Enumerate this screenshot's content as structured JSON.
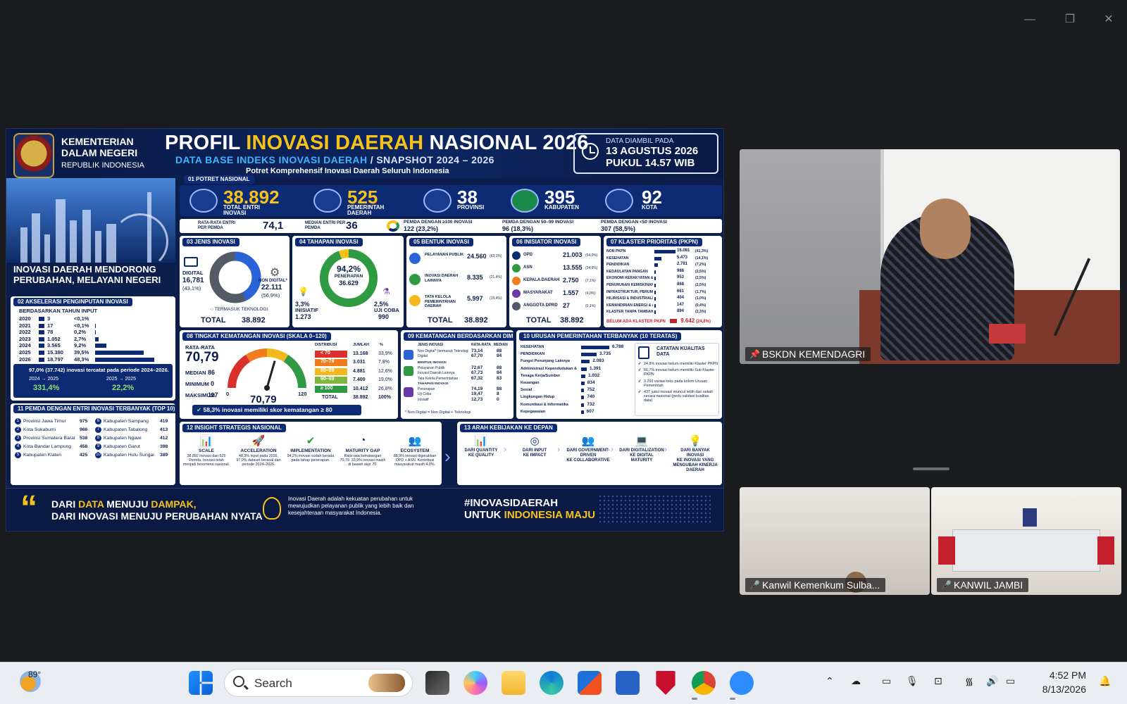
{
  "infographic": {
    "ministry": {
      "line1": "KEMENTERIAN",
      "line2": "DALAM NEGERI",
      "line3": "REPUBLIK INDONESIA"
    },
    "title_a": "PROFIL ",
    "title_b": "INOVASI DAERAH",
    "title_c": " NASIONAL 2026",
    "subtitle_a": "DATA BASE INDEKS INOVASI DAERAH",
    "subtitle_b": "  /  SNAPSHOT 2024 – 2026",
    "subtitle2": "Potret Komprehensif Inovasi Daerah Seluruh Indonesia",
    "date_label": "DATA DIAMBIL PADA",
    "date_value": "13 AGUSTUS 2026",
    "time_value": "PUKUL 14.57 WIB",
    "tagline": "INOVASI DAERAH MENDORONG PERUBAHAN, MELAYANI NEGERI",
    "potret": {
      "title": "01  POTRET NASIONAL",
      "items": [
        {
          "num": "38.892",
          "label": "TOTAL ENTRI INOVASI"
        },
        {
          "num": "525",
          "label": "PEMERINTAH DAERAH"
        },
        {
          "num": "38",
          "label": "PROVINSI"
        },
        {
          "num": "395",
          "label": "KABUPATEN"
        },
        {
          "num": "92",
          "label": "KOTA"
        }
      ],
      "row2": [
        {
          "label": "RATA-RATA ENTRI PER PEMDA",
          "value": "74,1"
        },
        {
          "label": "MEDIAN ENTRI PER PEMDA",
          "value": "36"
        },
        {
          "label": "PEMDA DENGAN ≥100 INOVASI",
          "value": "122 (23,2%)"
        },
        {
          "label": "PEMDA DENGAN 50–99 INOVASI",
          "value": "96 (18,3%)"
        },
        {
          "label": "PEMDA DENGAN <50 INOVASI",
          "value": "307 (58,5%)"
        }
      ]
    },
    "akselerasi": {
      "title": "02  AKSELERASI PENGINPUTAN INOVASI",
      "note": "BERDASARKAN TAHUN INPUT",
      "years": [
        {
          "y": "2020",
          "v": "3",
          "p": "<0,1%",
          "frac": 0.0
        },
        {
          "y": "2021",
          "v": "17",
          "p": "<0,1%",
          "frac": 0.001
        },
        {
          "y": "2022",
          "v": "78",
          "p": "0,2%",
          "frac": 0.005
        },
        {
          "y": "2023",
          "v": "1.052",
          "p": "2,7%",
          "frac": 0.056
        },
        {
          "y": "2024",
          "v": "3.565",
          "p": "9,2%",
          "frac": 0.19
        },
        {
          "y": "2025",
          "v": "15.380",
          "p": "39,5%",
          "frac": 0.82
        },
        {
          "y": "2026",
          "v": "18.797",
          "p": "48,3%",
          "frac": 1.0
        }
      ],
      "summary": "97,0% (37.742) inovasi tercatat pada periode 2024–2026.",
      "growth": [
        {
          "label": "2024 → 2025",
          "value": "331,4%"
        },
        {
          "label": "2025 → 2025",
          "value": "22,2%"
        }
      ]
    },
    "top10": {
      "title": "11  PEMDA DENGAN ENTRI INOVASI TERBANYAK (TOP 10)",
      "left": [
        {
          "n": "1",
          "name": "Provinsi Jawa Timur",
          "v": "975"
        },
        {
          "n": "2",
          "name": "Kota Sukabumi",
          "v": "966"
        },
        {
          "n": "3",
          "name": "Provinsi Sumatera Barat",
          "v": "538"
        },
        {
          "n": "4",
          "name": "Kota Bandar Lampung",
          "v": "458"
        },
        {
          "n": "5",
          "name": "Kabupaten Klaten",
          "v": "425"
        }
      ],
      "right": [
        {
          "n": "6",
          "name": "Kabupaten Sampang",
          "v": "419"
        },
        {
          "n": "7",
          "name": "Kabupaten Tabalong",
          "v": "413"
        },
        {
          "n": "8",
          "name": "Kabupaten Ngawi",
          "v": "412"
        },
        {
          "n": "9",
          "name": "Kabupaten Garut",
          "v": "398"
        },
        {
          "n": "10",
          "name": "Kabupaten Hulu Sungai Utara",
          "v": "389"
        }
      ]
    },
    "jenis": {
      "title": "03  JENIS INOVASI",
      "digital_label": "DIGITAL",
      "digital_value": "16,781",
      "digital_pct": "(43,1%)",
      "nondigital_label": "NON DIGITAL*",
      "nondigital_value": "22.111",
      "nondigital_pct": "(56,9%)",
      "note": "TERMASUK TEKNOLOGI",
      "total_label": "TOTAL",
      "total": "38.892",
      "digital_frac": 0.431
    },
    "tahapan": {
      "title": "04  TAHAPAN INOVASI",
      "center_pct": "94,2%",
      "center_label": "PENERAPAN",
      "center_value": "36.629",
      "inisiatif_pct": "3,3%",
      "inisiatif_label": "INISIATIF",
      "inisiatif_value": "1.273",
      "uji_pct": "2,5%",
      "uji_label": "UJI COBA",
      "uji_value": "990",
      "frac": 0.942
    },
    "bentuk": {
      "title": "05  BENTUK INOVASI",
      "rows": [
        {
          "label": "PELAYANAN PUBLIK",
          "v": "24.560",
          "p": "(63,1%)"
        },
        {
          "label": "INOVASI DAERAH LAINNYA",
          "v": "8.335",
          "p": "(21,4%)"
        },
        {
          "label": "TATA KELOLA PEMERINTAHAN DAERAH",
          "v": "5.997",
          "p": "(15,4%)"
        }
      ],
      "total_label": "TOTAL",
      "total": "38.892"
    },
    "inisiator": {
      "title": "06  INISIATOR INOVASI",
      "rows": [
        {
          "label": "OPD",
          "v": "21.003",
          "p": "(54,0%)"
        },
        {
          "label": "ASN",
          "v": "13.555",
          "p": "(34,9%)"
        },
        {
          "label": "KEPALA DAERAH",
          "v": "2.750",
          "p": "(7,1%)"
        },
        {
          "label": "MASYARAKAT",
          "v": "1.557",
          "p": "(4,0%)"
        },
        {
          "label": "ANGGOTA DPRD",
          "v": "27",
          "p": "(0,1%)"
        }
      ],
      "total_label": "TOTAL",
      "total": "38.892"
    },
    "klaster": {
      "title": "07  KLASTER PRIORITAS (PKPN)",
      "rows": [
        {
          "label": "NON PKPN",
          "v": "16.081",
          "p": "(41,3%)",
          "frac": 1.0
        },
        {
          "label": "KESEHATAN",
          "v": "5.473",
          "p": "(14,1%)",
          "frac": 0.34
        },
        {
          "label": "PENDIDIKAN",
          "v": "2.781",
          "p": "(7,2%)",
          "frac": 0.17
        },
        {
          "label": "KEDAULATAN PANGAN",
          "v": "988",
          "p": "(2,5%)",
          "frac": 0.06
        },
        {
          "label": "EKONOMI KERAKYATAN & DESA",
          "v": "953",
          "p": "(2,5%)",
          "frac": 0.06
        },
        {
          "label": "PENURUNAN KEMISKINAN",
          "v": "868",
          "p": "(2,5%)",
          "frac": 0.054
        },
        {
          "label": "INFRASTRUKTUR, PERUMAHAN & PENANGGULANGAN BENCANA",
          "v": "661",
          "p": "(1,7%)",
          "frac": 0.041
        },
        {
          "label": "HILIRISASI & INDUSTRIALISASI",
          "v": "404",
          "p": "(1,0%)",
          "frac": 0.025
        },
        {
          "label": "KEMANDIRIAN ENERGI & AIR",
          "v": "147",
          "p": "(0,4%)",
          "frac": 0.009
        },
        {
          "label": "KLASTER TANPA TAMBAHAN",
          "v": "894",
          "p": "(2,3%)",
          "frac": 0.056
        }
      ],
      "empty_label": "BELUM ADA KLASTER PKPN",
      "empty_value": "9.642",
      "empty_pct": "(24,8%)"
    },
    "kematangan": {
      "title": "08  TINGKAT KEMATANGAN INOVASI (SKALA 0–120)",
      "avg_label": "RATA-RATA",
      "avg": "70,79",
      "median_label": "MEDIAN",
      "median": "86",
      "min_label": "MINIMUM",
      "min": "0",
      "max_label": "MAKSIMUM",
      "max": "117",
      "gauge_value": "70,79",
      "gauge_min": "0",
      "gauge_max": "120",
      "gauge_frac": 0.59,
      "dist_headers": [
        "DISTRIBUSI",
        "JUMLAH",
        "%"
      ],
      "dist": [
        {
          "r": "< 70",
          "v": "13.168",
          "p": "33,9%",
          "c": "#d9302c"
        },
        {
          "r": "70–79",
          "v": "3.031",
          "p": "7,8%",
          "c": "#ef7d1e"
        },
        {
          "r": "80–89",
          "v": "4.881",
          "p": "12,6%",
          "c": "#f2b81c"
        },
        {
          "r": "90–99",
          "v": "7.400",
          "p": "19,0%",
          "c": "#7fb73a"
        },
        {
          "r": "≥ 100",
          "v": "10.412",
          "p": "26,8%",
          "c": "#2f9a44"
        }
      ],
      "dist_total_label": "TOTAL",
      "dist_total": "38.892",
      "dist_total_pct": "100%",
      "note": "58,3% inovasi memiliki skor kematangan ≥ 80"
    },
    "dimensi": {
      "title": "09  KEMATANGAN BERDASARKAN DIMENSI",
      "headers": [
        "JENIS INOVASI",
        "RATA-RATA",
        "MEDIAN"
      ],
      "groups": [
        {
          "name": "JENIS INOVASI",
          "rows": [
            {
              "l": "Non Digital* (termasuk Teknologi)",
              "a": "73,14",
              "m": "88"
            },
            {
              "l": "Digital",
              "a": "67,70",
              "m": "84"
            }
          ]
        },
        {
          "name": "BENTUK INOVASI",
          "rows": [
            {
              "l": "Pelayanan Publik",
              "a": "72,67",
              "m": "88"
            },
            {
              "l": "Inovasi Daerah Lainnya",
              "a": "67,73",
              "m": "84"
            },
            {
              "l": "Tata Kelola Pemerintahan",
              "a": "67,32",
              "m": "83"
            }
          ]
        },
        {
          "name": "TAHAPAN INOVASI",
          "rows": [
            {
              "l": "Penerapan",
              "a": "74,19",
              "m": "88"
            },
            {
              "l": "Uji Coba",
              "a": "19,47",
              "m": "8"
            },
            {
              "l": "Inisiatif",
              "a": "12,73",
              "m": "0"
            }
          ]
        }
      ],
      "note": "* Non Digital = Non Digital + Teknologi"
    },
    "urusan": {
      "title": "10  URUSAN PEMERINTAHAN TERBANYAK (10 TERATAS)",
      "rows": [
        {
          "l": "KESEHATAN",
          "v": "6.788",
          "frac": 1.0
        },
        {
          "l": "PENDIDIKAN",
          "v": "3.735",
          "frac": 0.55
        },
        {
          "l": "Fungsi Penunjang Lainnya",
          "v": "2.083",
          "frac": 0.31
        },
        {
          "l": "Administrasi Kependudukan & Pencatatan Sipil",
          "v": "1.391",
          "frac": 0.2
        },
        {
          "l": "Tenaga Kerja/Sumber",
          "v": "1.032",
          "frac": 0.15
        },
        {
          "l": "Keuangan",
          "v": "834",
          "frac": 0.12
        },
        {
          "l": "Sosial",
          "v": "752",
          "frac": 0.11
        },
        {
          "l": "Lingkungan Hidup",
          "v": "740",
          "frac": 0.11
        },
        {
          "l": "Komunikasi & Informatika",
          "v": "732",
          "frac": 0.11
        },
        {
          "l": "Kepegawaian",
          "v": "607",
          "frac": 0.09
        }
      ],
      "kualitas_title": "CATATAN KUALITAS DATA",
      "kualitas": [
        "24,8% inovasi belum memiliki Klaster PKPN",
        "66,7% inovasi belum memiliki Sub Klaster PKPN",
        "3.293 variasi teks pada kolom Urusan Pemerintah",
        "437 judul inovasi muncul lebih dari sekali secara nasional (perlu validasi kualitas data)"
      ]
    },
    "insight": {
      "title": "12  INSIGHT STRATEGIS NASIONAL",
      "items": [
        {
          "h": "SCALE",
          "t": "38.892 inovasi dari 525 Pemda. Inovasi telah menjadi fenomena nasional."
        },
        {
          "h": "ACCELERATION",
          "t": "48,3% input pada 2026. 97,0% dataset berasal dari periode 2024–2026."
        },
        {
          "h": "IMPLEMENTATION",
          "t": "94,2% inovasi sudah berada pada tahap penerapan."
        },
        {
          "h": "MATURITY GAP",
          "t": "Rata-rata kematangan 70,79. 33,9% inovasi masih di bawah skor 70."
        },
        {
          "h": "ECOSYSTEM",
          "t": "88,9% inovasi digerakkan OPD + ASN. Kontribusi masyarakat masih 4,0%."
        }
      ]
    },
    "arah": {
      "title": "13  ARAH KEBIJAKAN KE DEPAN",
      "items": [
        {
          "a": "DARI QUANTITY",
          "b": "KE QUALITY"
        },
        {
          "a": "DARI INPUT",
          "b": "KE IMPACT"
        },
        {
          "a": "DARI GOVERNMENT-DRIVEN",
          "b": "KE COLLABORATIVE"
        },
        {
          "a": "DARI DIGITALIZATION",
          "b": "KE DIGITAL MATURITY"
        },
        {
          "a": "DARI BANYAK INOVASI",
          "b": "KE INOVASI YANG MENGUBAH KINERJA DAERAH"
        }
      ]
    },
    "footer": {
      "s1a": "DARI ",
      "s1b": "DATA",
      "s1c": " MENUJU ",
      "s1d": "DAMPAK,",
      "s2": "DARI INOVASI MENUJU PERUBAHAN NYATA",
      "desc": "Inovasi Daerah adalah kekuatan perubahan untuk mewujudkan pelayanan publik yang lebih baik dan kesejahteraan masyarakat Indonesia.",
      "hashtag1": "#INOVASIDAERAH",
      "hashtag2a": "UNTUK ",
      "hashtag2b": "INDONESIA MAJU"
    }
  },
  "participants": [
    {
      "name": "BSKDN KEMENDAGRI"
    },
    {
      "name": "Kanwil Kemenkum Sulba..."
    },
    {
      "name": "KANWIL JAMBI"
    }
  ],
  "taskbar": {
    "weather": "89°",
    "search_placeholder": "Search",
    "time": "4:52 PM",
    "date": "8/13/2026"
  }
}
